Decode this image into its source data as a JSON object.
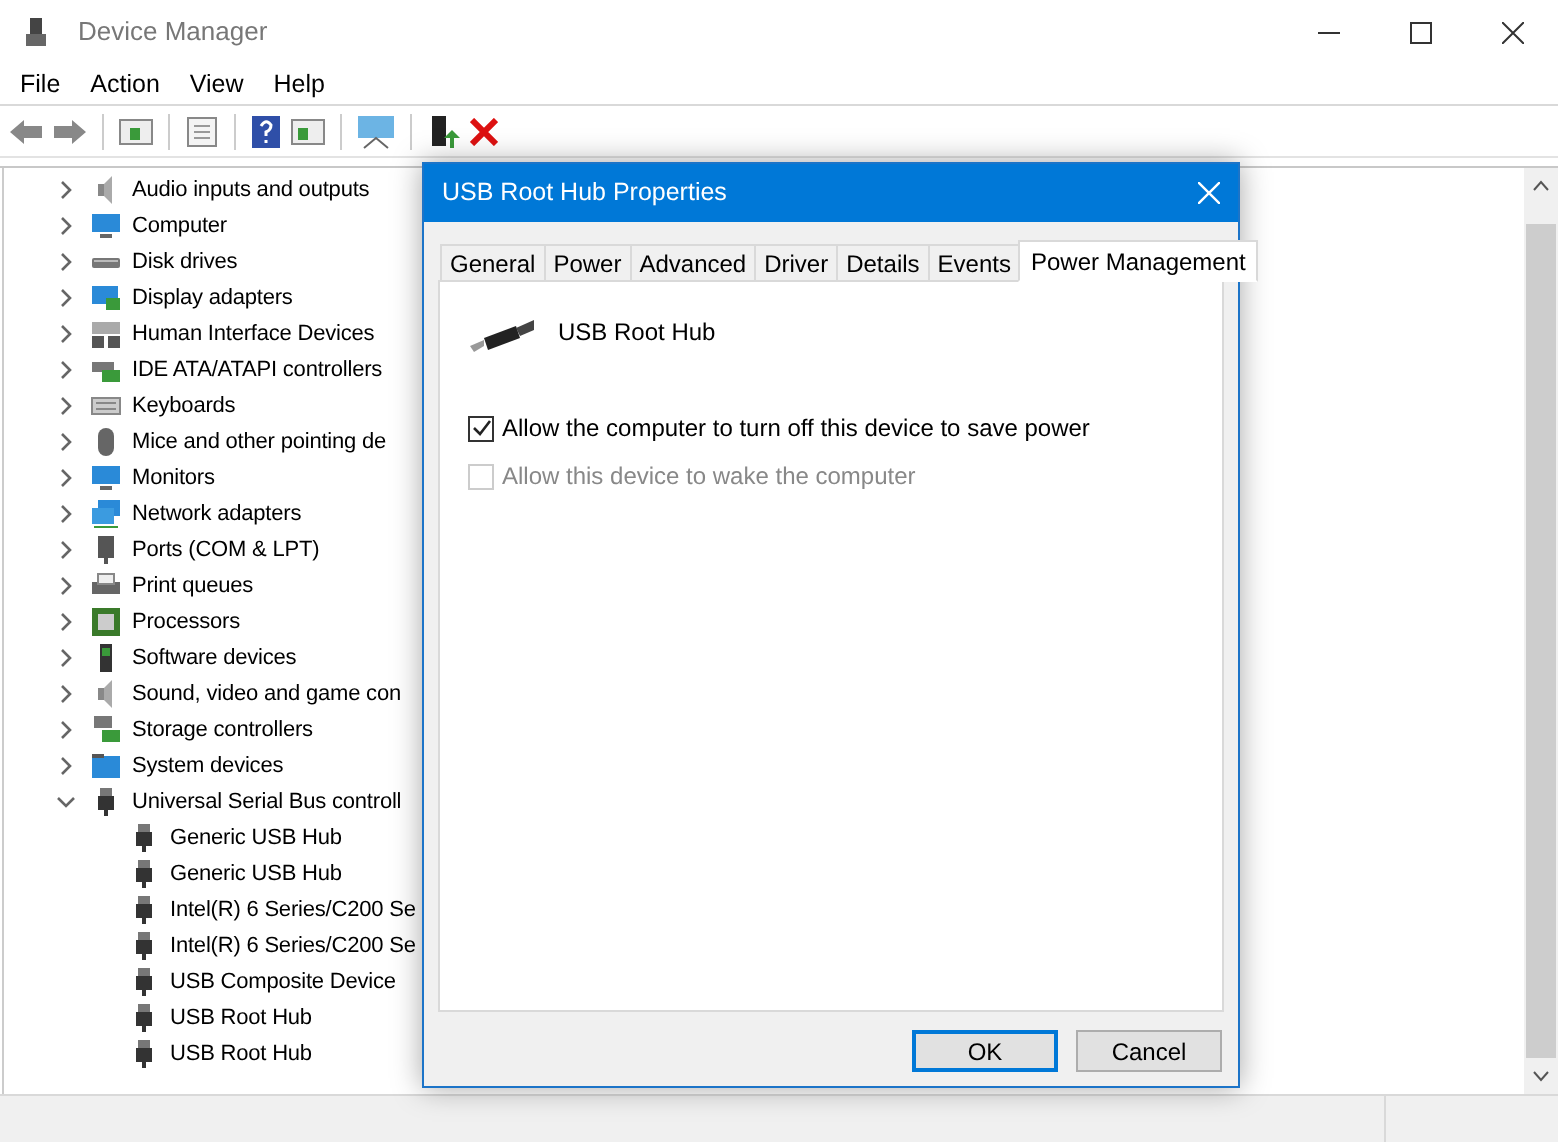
{
  "window": {
    "title": "Device Manager"
  },
  "menu": [
    "File",
    "Action",
    "View",
    "Help"
  ],
  "tree": [
    {
      "label": "Audio inputs and outputs",
      "expanded": false
    },
    {
      "label": "Computer",
      "expanded": false
    },
    {
      "label": "Disk drives",
      "expanded": false
    },
    {
      "label": "Display adapters",
      "expanded": false
    },
    {
      "label": "Human Interface Devices",
      "expanded": false
    },
    {
      "label": "IDE ATA/ATAPI controllers",
      "expanded": false
    },
    {
      "label": "Keyboards",
      "expanded": false
    },
    {
      "label": "Mice and other pointing de",
      "expanded": false
    },
    {
      "label": "Monitors",
      "expanded": false
    },
    {
      "label": "Network adapters",
      "expanded": false
    },
    {
      "label": "Ports (COM & LPT)",
      "expanded": false
    },
    {
      "label": "Print queues",
      "expanded": false
    },
    {
      "label": "Processors",
      "expanded": false
    },
    {
      "label": "Software devices",
      "expanded": false
    },
    {
      "label": "Sound, video and game con",
      "expanded": false
    },
    {
      "label": "Storage controllers",
      "expanded": false
    },
    {
      "label": "System devices",
      "expanded": false
    },
    {
      "label": "Universal Serial Bus controll",
      "expanded": true,
      "children": [
        {
          "label": "Generic USB Hub"
        },
        {
          "label": "Generic USB Hub"
        },
        {
          "label": "Intel(R) 6 Series/C200 Se"
        },
        {
          "label": "Intel(R) 6 Series/C200 Se"
        },
        {
          "label": "USB Composite Device"
        },
        {
          "label": "USB Root Hub"
        },
        {
          "label": "USB Root Hub"
        }
      ]
    }
  ],
  "dialog": {
    "title": "USB Root Hub Properties",
    "tabs": [
      {
        "label": "General",
        "selected": false
      },
      {
        "label": "Power",
        "selected": false
      },
      {
        "label": "Advanced",
        "selected": false
      },
      {
        "label": "Driver",
        "selected": false
      },
      {
        "label": "Details",
        "selected": false
      },
      {
        "label": "Events",
        "selected": false
      },
      {
        "label": "Power Management",
        "selected": true
      }
    ],
    "device_name": "USB Root Hub",
    "options": [
      {
        "label": "Allow the computer to turn off this device to save power",
        "checked": true,
        "disabled": false
      },
      {
        "label": "Allow this device to wake the computer",
        "checked": false,
        "disabled": true
      }
    ],
    "buttons": [
      {
        "label": "OK",
        "kind": "default"
      },
      {
        "label": "Cancel",
        "kind": "normal"
      }
    ]
  }
}
